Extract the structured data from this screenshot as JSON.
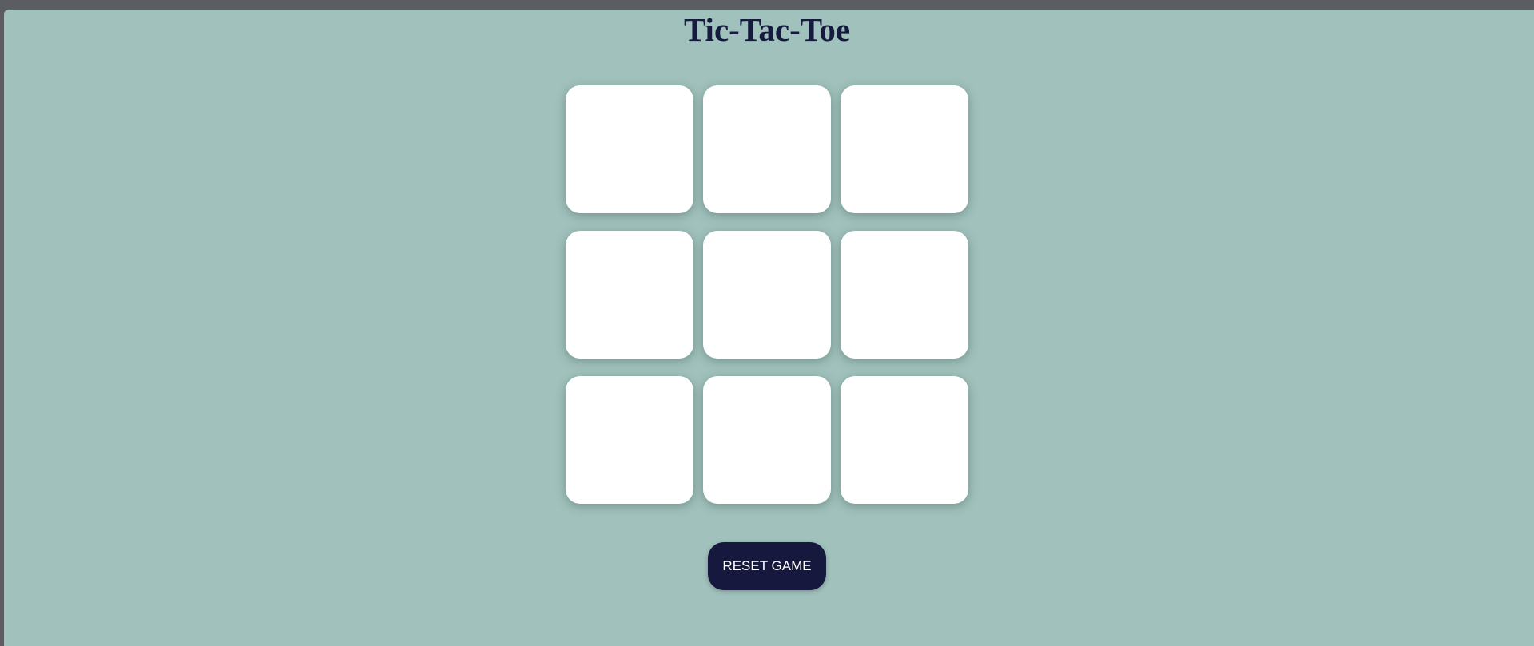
{
  "game": {
    "title": "Tic-Tac-Toe",
    "cells": [
      "",
      "",
      "",
      "",
      "",
      "",
      "",
      "",
      ""
    ],
    "reset_label": "RESET GAME"
  },
  "colors": {
    "background": "#a1c1bc",
    "title": "#151a3f",
    "cell": "#ffffff",
    "button": "#17183d",
    "button_text": "#ffffff"
  }
}
